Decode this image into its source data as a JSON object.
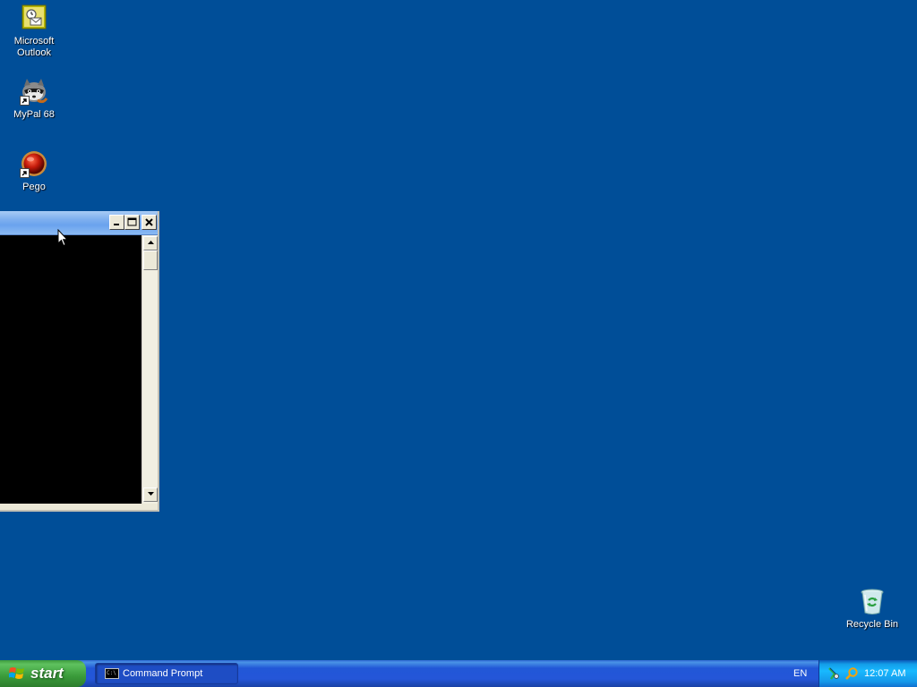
{
  "desktop": {
    "icons": [
      {
        "label_line1": "Microsoft",
        "label_line2": "Outlook",
        "icon": "outlook-icon"
      },
      {
        "label": "MyPal 68",
        "icon": "mypal-raccoon-icon"
      },
      {
        "label": "Pego",
        "icon": "pego-red-orb-icon"
      }
    ],
    "recycle_bin": {
      "label": "Recycle Bin",
      "icon": "recycle-bin-icon"
    }
  },
  "cmd_window": {
    "caption_buttons": {
      "minimize": "minimize-icon",
      "maximize": "maximize-icon",
      "close": "close-icon"
    }
  },
  "taskbar": {
    "start_label": "start",
    "tasks": [
      {
        "label": "Command Prompt",
        "icon": "cmd-icon",
        "icon_text": "C:\\"
      }
    ],
    "language": "EN",
    "tray_icons": [
      "network-icon",
      "search-icon"
    ],
    "clock": "12:07 AM"
  },
  "colors": {
    "desktop_background": "#004e98",
    "taskbar_blue": "#2456d8",
    "start_green": "#3a9b3a",
    "tray_blue": "#18b9ff"
  }
}
